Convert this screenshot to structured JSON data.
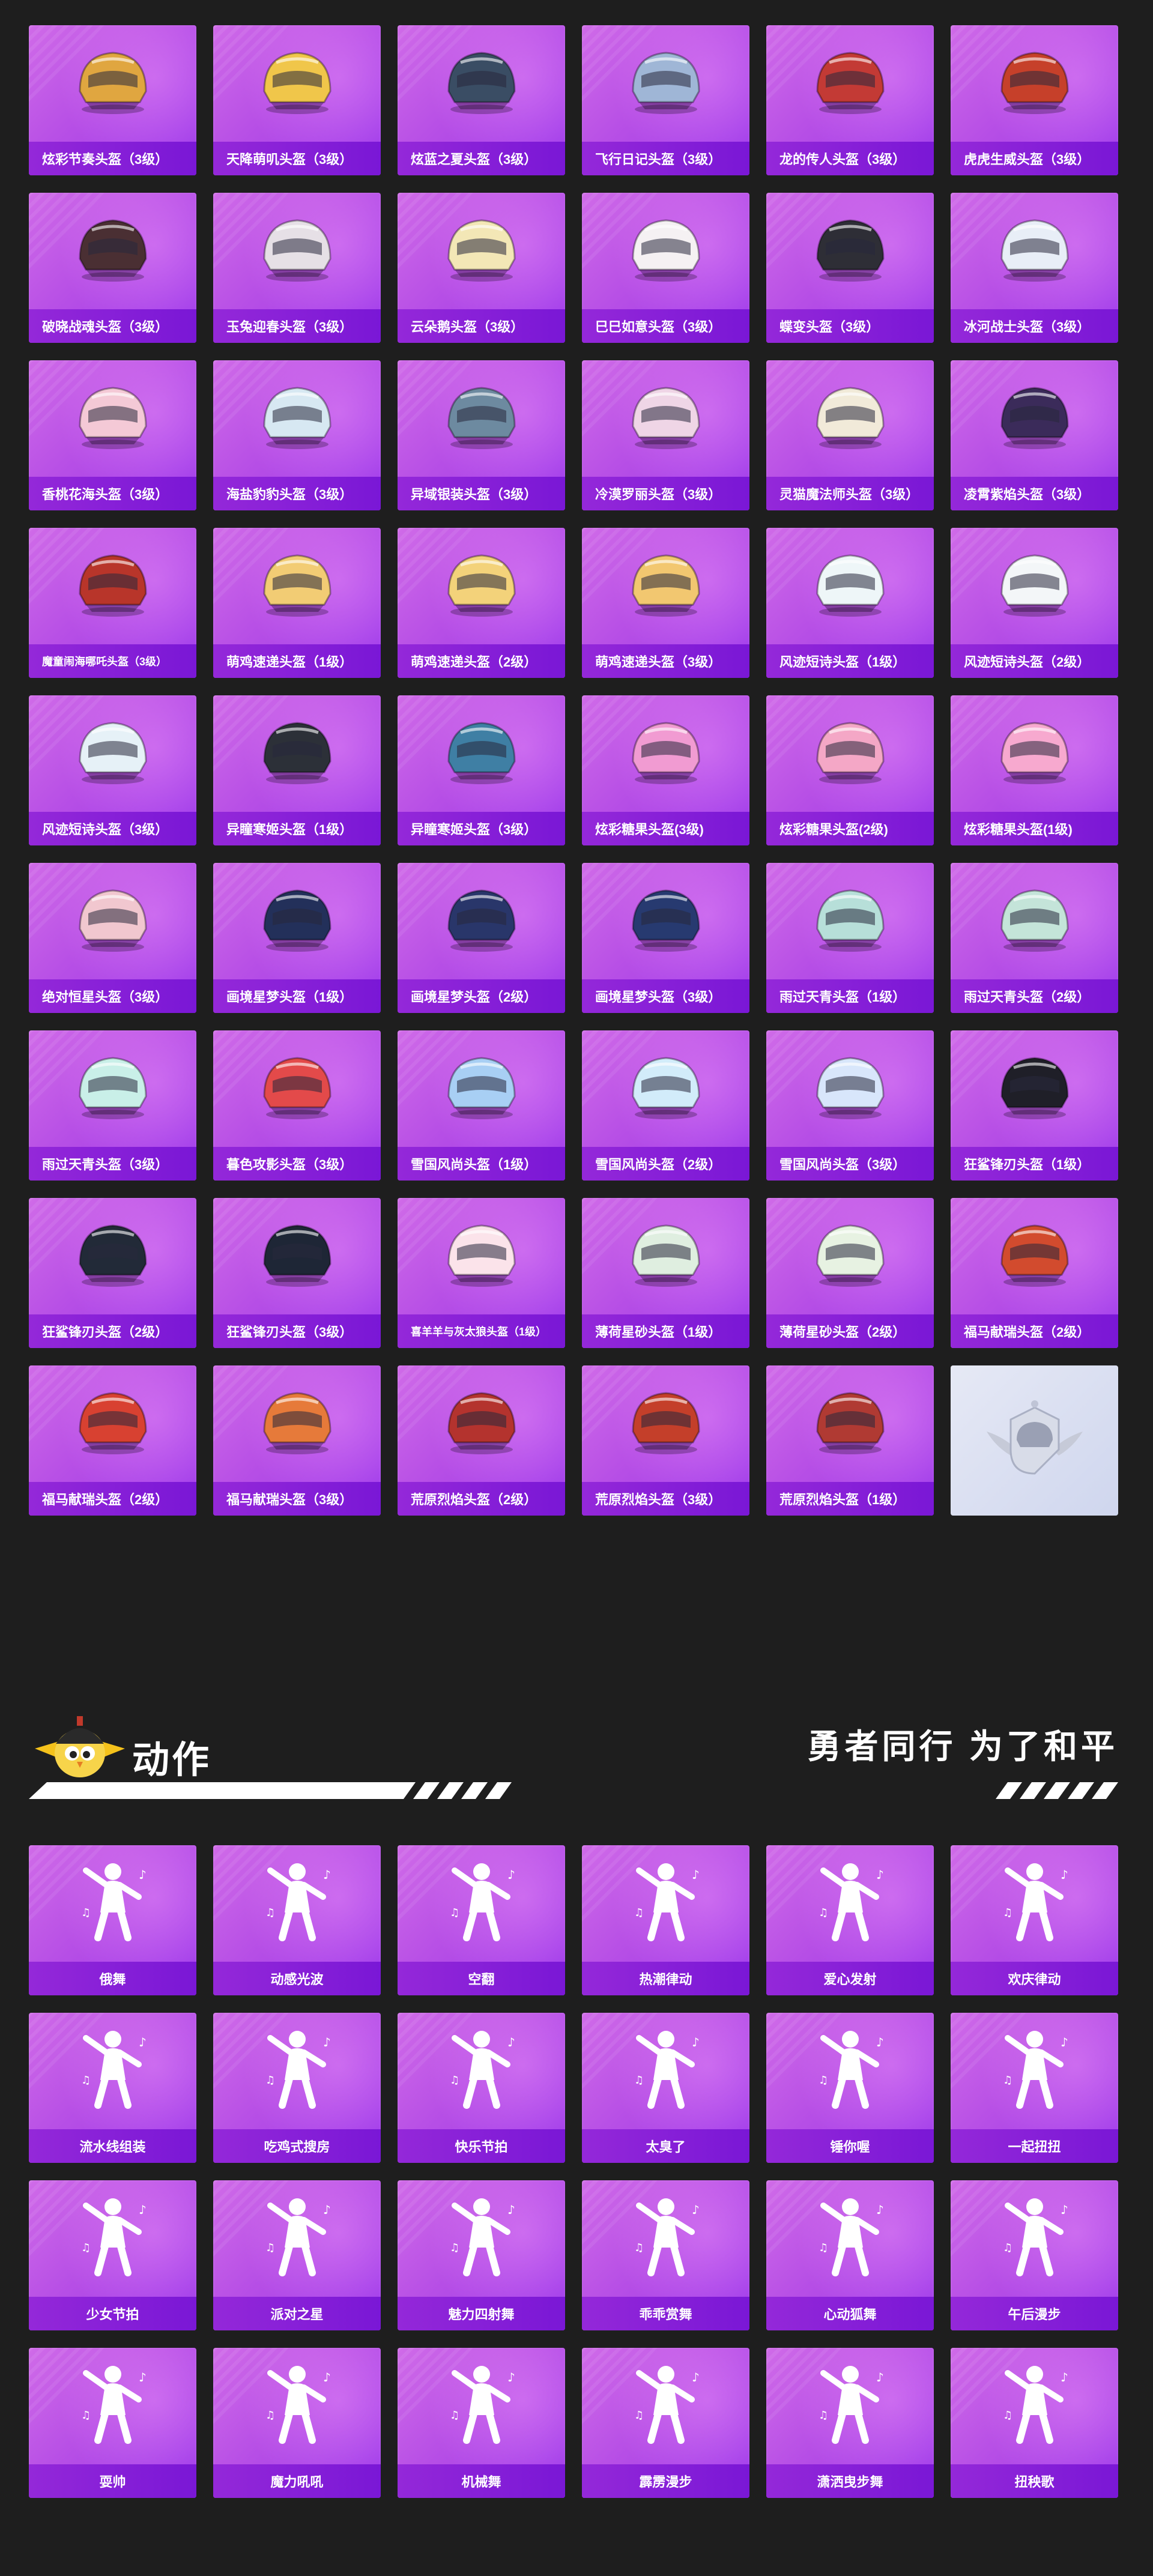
{
  "helmets": [
    [
      "炫彩节奏头盔（3级）",
      "天降萌叽头盔（3级）",
      "炫蓝之夏头盔（3级）",
      "飞行日记头盔（3级）",
      "龙的传人头盔（3级）",
      "虎虎生威头盔（3级）"
    ],
    [
      "破晓战魂头盔（3级）",
      "玉兔迎春头盔（3级）",
      "云朵鹅头盔（3级）",
      "巳巳如意头盔（3级）",
      "蝶变头盔（3级）",
      "冰河战士头盔（3级）"
    ],
    [
      "香桃花海头盔（3级）",
      "海盐豹豹头盔（3级）",
      "异域银装头盔（3级）",
      "冷漠罗丽头盔（3级）",
      "灵猫魔法师头盔（3级）",
      "凌霄紫焰头盔（3级）"
    ],
    [
      "魔童闹海哪吒头盔（3级）",
      "萌鸡速递头盔（1级）",
      "萌鸡速递头盔（2级）",
      "萌鸡速递头盔（3级）",
      "风迹短诗头盔（1级）",
      "风迹短诗头盔（2级）"
    ],
    [
      "风迹短诗头盔（3级）",
      "异瞳寒姬头盔（1级）",
      "异瞳寒姬头盔（3级）",
      "炫彩糖果头盔(3级)",
      "炫彩糖果头盔(2级)",
      "炫彩糖果头盔(1级)"
    ],
    [
      "绝对恒星头盔（3级）",
      "画境星梦头盔（1级）",
      "画境星梦头盔（2级）",
      "画境星梦头盔（3级）",
      "雨过天青头盔（1级）",
      "雨过天青头盔（2级）"
    ],
    [
      "雨过天青头盔（3级）",
      "暮色攻影头盔（3级）",
      "雪国风尚头盔（1级）",
      "雪国风尚头盔（2级）",
      "雪国风尚头盔（3级）",
      "狂鲨锋刃头盔（1级）"
    ],
    [
      "狂鲨锋刃头盔（2级）",
      "狂鲨锋刃头盔（3级）",
      "喜羊羊与灰太狼头盔（1级）",
      "薄荷星砂头盔（1级）",
      "薄荷星砂头盔（2级）",
      "福马献瑞头盔（2级）"
    ],
    [
      "福马献瑞头盔（2级）",
      "福马献瑞头盔（3级）",
      "荒原烈焰头盔（2级）",
      "荒原烈焰头盔（3级）",
      "荒原烈焰头盔（1级）",
      ""
    ]
  ],
  "helmet_colors": [
    [
      "#e0a640",
      "#f0c64a",
      "#3a4d64",
      "#9fb6d6",
      "#c33a35",
      "#c6402a"
    ],
    [
      "#4a2f33",
      "#e6e0e6",
      "#f3e7b6",
      "#f5f1f3",
      "#2e2e36",
      "#e8eef7"
    ],
    [
      "#f4c9d6",
      "#d7e8f2",
      "#6d8aa0",
      "#efd5e6",
      "#f1ead9",
      "#3b2b5a"
    ],
    [
      "#b8352a",
      "#f2cc74",
      "#f3d27a",
      "#f2c770",
      "#eef6f8",
      "#f3f6f8"
    ],
    [
      "#e6f1f7",
      "#2c3038",
      "#3f7fa4",
      "#f19bd2",
      "#f4a7c6",
      "#f7a9cf"
    ],
    [
      "#f1c7cf",
      "#23305a",
      "#29366a",
      "#273a70",
      "#b7dfd9",
      "#c4e4d9"
    ],
    [
      "#c9efe8",
      "#e34a4a",
      "#a8cff4",
      "#d2ecfa",
      "#d8e6fb",
      "#1f1f28"
    ],
    [
      "#222a38",
      "#1e2636",
      "#fbe3ea",
      "#dfeee0",
      "#e7f2e2",
      "#d24b2e"
    ],
    [
      "#d84131",
      "#e67a3a",
      "#b4332e",
      "#c43f2a",
      "#b03a33",
      "#ffffff"
    ]
  ],
  "section": {
    "title": "动作",
    "slogan": "勇者同行 为了和平"
  },
  "emotes": [
    [
      "俄舞",
      "动感光波",
      "空翻",
      "热潮律动",
      "爱心发射",
      "欢庆律动"
    ],
    [
      "流水线组装",
      "吃鸡式搜房",
      "快乐节拍",
      "太臭了",
      "锤你喔",
      "一起扭扭"
    ],
    [
      "少女节拍",
      "派对之星",
      "魅力四射舞",
      "乖乖赏舞",
      "心动狐舞",
      "午后漫步"
    ],
    [
      "耍帅",
      "魔力吼吼",
      "机械舞",
      "霹雳漫步",
      "潇洒曳步舞",
      "扭秧歌"
    ]
  ]
}
